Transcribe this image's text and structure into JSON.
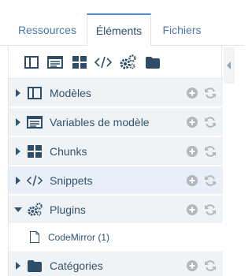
{
  "tabs": [
    {
      "label": "Ressources",
      "active": false
    },
    {
      "label": "Éléments",
      "active": true
    },
    {
      "label": "Fichiers",
      "active": false
    }
  ],
  "toolbar": {
    "icons": [
      "new-template-icon",
      "new-tv-icon",
      "new-chunk-icon",
      "new-snippet-icon",
      "new-plugin-icon",
      "new-category-icon"
    ]
  },
  "tree": {
    "items": [
      {
        "label": "Modèles",
        "icon": "template-icon",
        "expanded": false
      },
      {
        "label": "Variables de modèle",
        "icon": "tv-icon",
        "expanded": false
      },
      {
        "label": "Chunks",
        "icon": "chunk-icon",
        "expanded": false
      },
      {
        "label": "Snippets",
        "icon": "snippet-icon",
        "expanded": false
      },
      {
        "label": "Plugins",
        "icon": "plugin-icon",
        "expanded": true
      },
      {
        "label": "Catégories",
        "icon": "folder-icon",
        "expanded": false
      }
    ],
    "plugin_children": [
      {
        "label": "CodeMirror (1)",
        "icon": "file-icon"
      }
    ]
  },
  "colors": {
    "accent": "#4a90e2",
    "row_bg": "#f0f3f6",
    "icon": "#2f4d66",
    "action_icon": "#b3b8bd"
  }
}
